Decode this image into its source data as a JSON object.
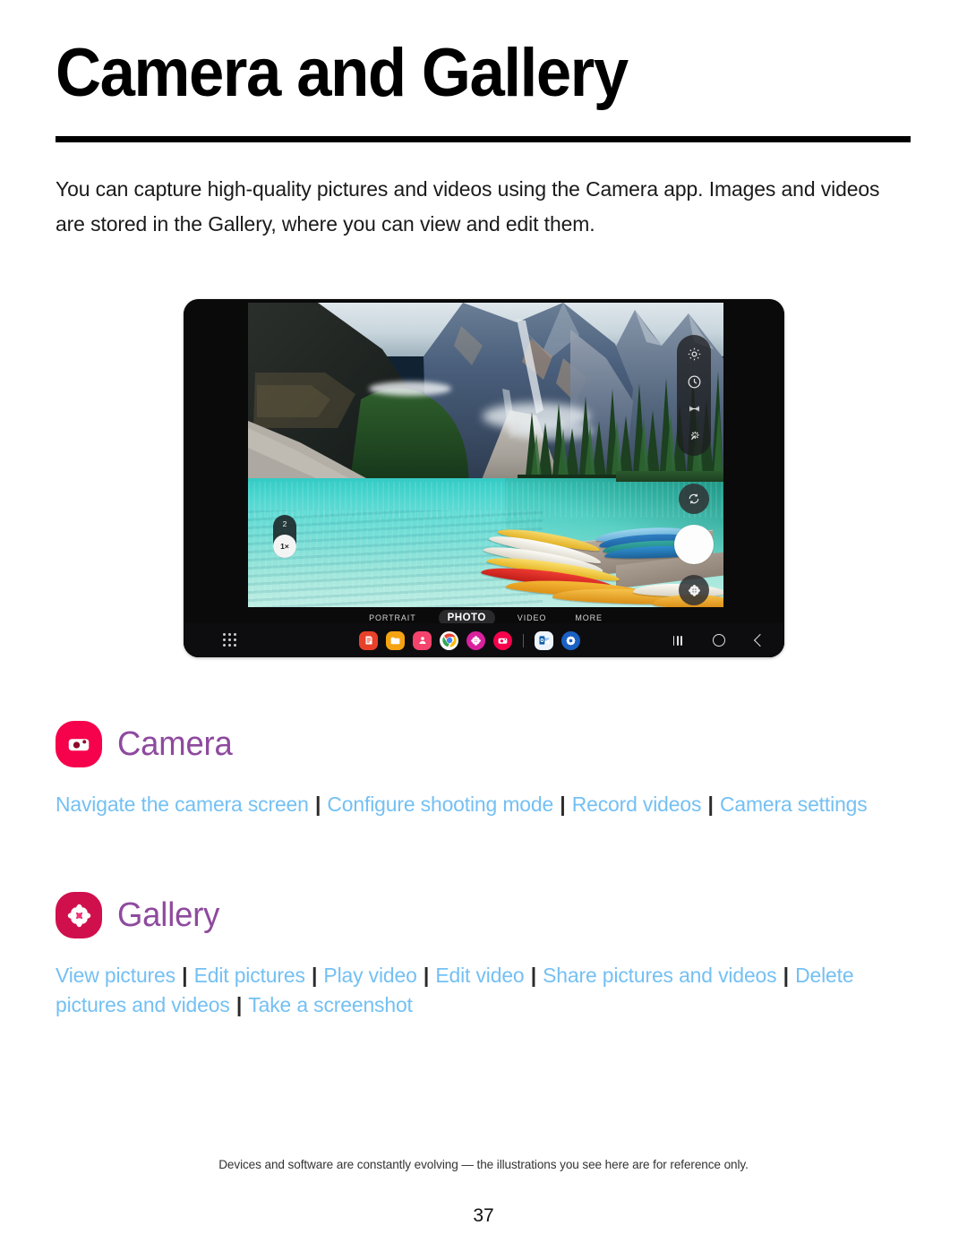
{
  "page": {
    "title": "Camera and Gallery",
    "intro": "You can capture high-quality pictures and videos using the Camera app. Images and videos are stored in the Gallery, where you can view and edit them.",
    "footer_note": "Devices and software are constantly evolving — the illustrations you see here are for reference only.",
    "page_number": "37"
  },
  "colors": {
    "link": "#74c0f3",
    "heading_purple": "#8e4a9e",
    "camera_badge": "#f5014c",
    "gallery_badge": "#d0104c",
    "rule": "#000000"
  },
  "device": {
    "name": "Samsung Galaxy Tab camera preview",
    "zoom": {
      "option_secondary": "2",
      "option_selected": "1×"
    },
    "modes": [
      {
        "label": "PORTRAIT",
        "active": false
      },
      {
        "label": "PHOTO",
        "active": true
      },
      {
        "label": "VIDEO",
        "active": false
      },
      {
        "label": "MORE",
        "active": false
      }
    ],
    "rail_icons": [
      "settings-gear-icon",
      "timer-icon",
      "aspect-ratio-icon",
      "effects-wand-icon"
    ],
    "controls": {
      "flip": "flip-camera-icon",
      "shutter": "shutter-button",
      "thumbnail": "gallery-thumbnail-icon"
    },
    "taskbar": {
      "apps_button": "all-apps-icon",
      "apps": [
        {
          "name": "samsung-notes-icon",
          "color": "#e8412a"
        },
        {
          "name": "my-files-icon",
          "color": "#f5a313"
        },
        {
          "name": "contacts-icon",
          "color": "#f4436c"
        },
        {
          "name": "chrome-icon",
          "color": "#ffffff"
        },
        {
          "name": "gallery-icon",
          "color": "#d9219e"
        },
        {
          "name": "camera-icon",
          "color": "#f5014c"
        },
        {
          "name": "outlook-icon",
          "color": "#edf3fb"
        },
        {
          "name": "settings-icon",
          "color": "#1a61c4"
        }
      ],
      "nav": [
        "recents-button",
        "home-button",
        "back-button"
      ]
    },
    "photo_caption": "Turquoise mountain lake with canoes at a wooden dock"
  },
  "sections": [
    {
      "id": "camera",
      "title": "Camera",
      "badge": "camera-app-icon",
      "links": [
        "Navigate the camera screen",
        "Configure shooting mode",
        "Record videos",
        "Camera settings"
      ]
    },
    {
      "id": "gallery",
      "title": "Gallery",
      "badge": "gallery-app-icon",
      "links": [
        "View pictures",
        "Edit pictures",
        "Play video",
        "Edit video",
        "Share pictures and videos",
        "Delete pictures and videos",
        "Take a screenshot"
      ]
    }
  ]
}
